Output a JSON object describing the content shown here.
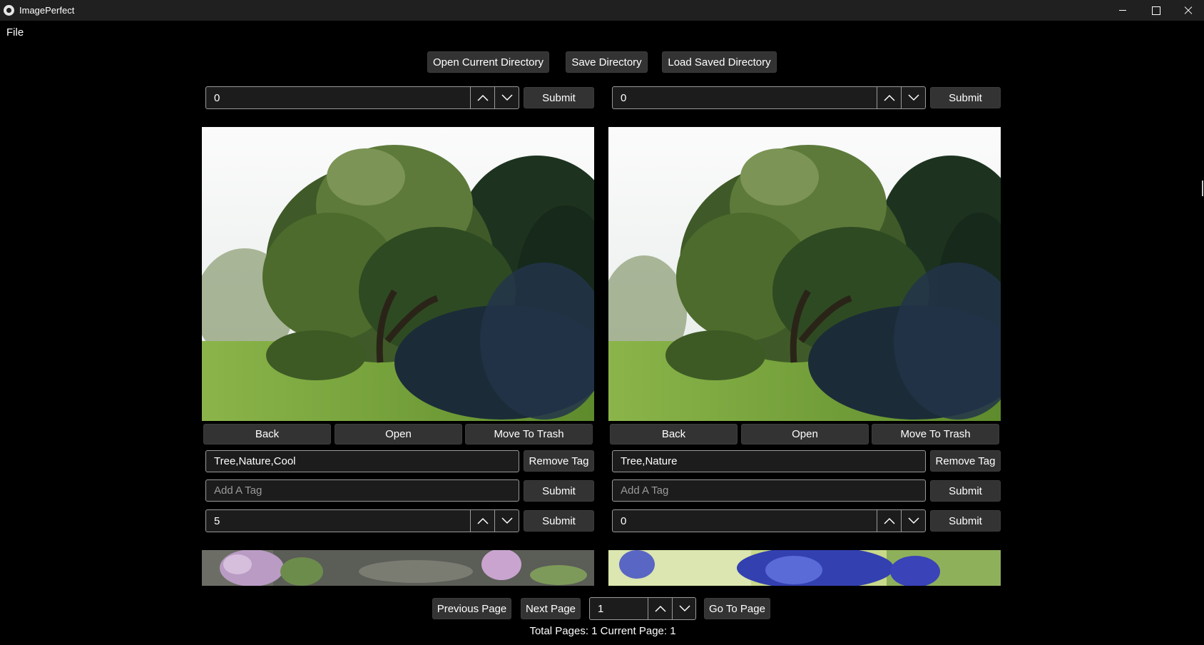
{
  "window": {
    "title": "ImagePerfect"
  },
  "menu": {
    "file": "File"
  },
  "toolbar": {
    "open_current": "Open Current Directory",
    "save_dir": "Save Directory",
    "load_saved": "Load Saved Directory"
  },
  "columns": [
    {
      "top_rating": "0",
      "top_submit": "Submit",
      "back": "Back",
      "open": "Open",
      "trash": "Move To Trash",
      "tags": "Tree,Nature,Cool",
      "remove_tag": "Remove Tag",
      "add_tag_placeholder": "Add A Tag",
      "tag_submit": "Submit",
      "rating": "5",
      "rating_submit": "Submit"
    },
    {
      "top_rating": "0",
      "top_submit": "Submit",
      "back": "Back",
      "open": "Open",
      "trash": "Move To Trash",
      "tags": "Tree,Nature",
      "remove_tag": "Remove Tag",
      "add_tag_placeholder": "Add A Tag",
      "tag_submit": "Submit",
      "rating": "0",
      "rating_submit": "Submit"
    }
  ],
  "pager": {
    "prev": "Previous Page",
    "next": "Next Page",
    "page_value": "1",
    "go": "Go To Page",
    "status": "Total Pages: 1 Current Page: 1"
  },
  "icons": {
    "up": "chevron-up-icon",
    "down": "chevron-down-icon",
    "app": "app-logo-icon"
  }
}
